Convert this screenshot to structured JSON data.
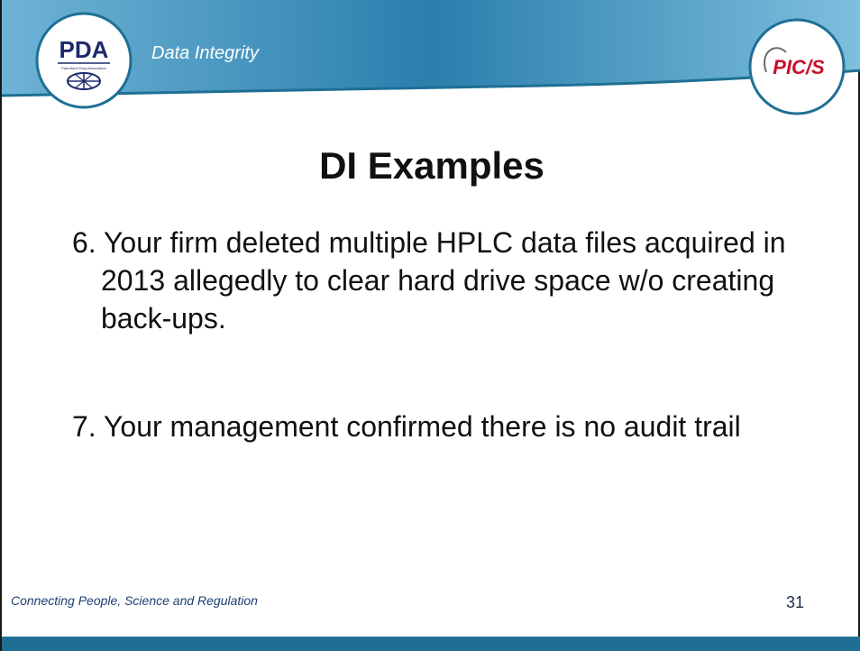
{
  "header": {
    "section_title": "Data Integrity",
    "left_logo": {
      "text": "PDA",
      "subtext": "Parenteral Drug Association"
    },
    "right_logo": {
      "text": "PIC/S"
    }
  },
  "slide": {
    "title": "DI Examples",
    "items": [
      "6. Your firm deleted multiple HPLC data files acquired in 2013 allegedly to clear hard drive space w/o creating back-ups.",
      "7. Your management confirmed there is no audit trail"
    ]
  },
  "footer": {
    "tagline": "Connecting People, Science and Regulation",
    "page_number": "31"
  },
  "colors": {
    "header_blue": "#2a7fad",
    "header_blue_light": "#6fb3d6",
    "footer_blue": "#1f6f95",
    "tagline_blue": "#1e3f73",
    "pics_red": "#c8102e",
    "pda_navy": "#1b2a6b"
  }
}
